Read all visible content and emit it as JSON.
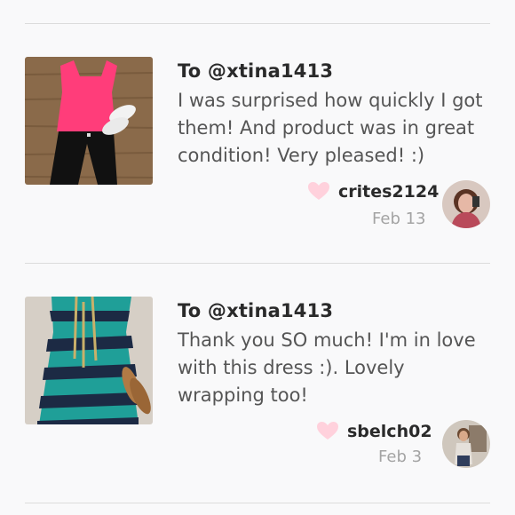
{
  "reviews": [
    {
      "to": "To @xtina1413",
      "message": "I was surprised how quickly I got them! And product was in great condition! Very pleased! :)",
      "username": "crites2124",
      "date": "Feb 13"
    },
    {
      "to": "To @xtina1413",
      "message": "Thank you SO much! I'm in love with this dress :). Lovely wrapping too!",
      "username": "sbelch02",
      "date": "Feb 3"
    }
  ],
  "colors": {
    "heart": "#ffd1dc",
    "text_primary": "#2a2a2a",
    "text_secondary": "#555555",
    "date": "#a3a3a3",
    "divider": "#dcdcdc"
  },
  "icons": [
    "heart-icon"
  ]
}
